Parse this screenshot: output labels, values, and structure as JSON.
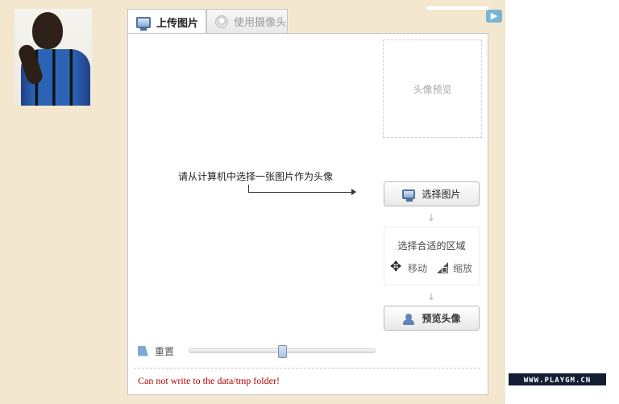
{
  "tabs": [
    {
      "label": "上传图片",
      "icon": "monitor-icon",
      "active": true
    },
    {
      "label": "使用摄像头",
      "icon": "webcam-icon",
      "active": false
    }
  ],
  "preview_box": {
    "label": "头像预览"
  },
  "hint": {
    "text": "请从计算机中选择一张图片作为头像"
  },
  "buttons": {
    "select_label": "选择图片",
    "preview_label": "预览头像"
  },
  "steps": {
    "title": "选择合适的区域",
    "move_label": "移动",
    "zoom_label": "缩放"
  },
  "reset": {
    "label": "重置"
  },
  "slider": {
    "value": 0.5
  },
  "error": {
    "text": "Can not write to the data/tmp folder!"
  },
  "watermark": {
    "text": "WWW.PLAYGM.CN"
  },
  "colors": {
    "background": "#f3e8cf",
    "error": "#b00000",
    "accent": "#4f6f9a"
  }
}
